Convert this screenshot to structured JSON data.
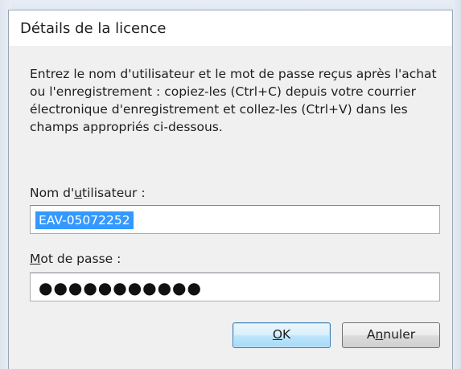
{
  "window": {
    "title": "Détails de la licence"
  },
  "instructions": "Entrez le nom d'utilisateur et le mot de passe reçus après l'achat ou l'enregistrement : copiez-les (Ctrl+C) depuis votre courrier électronique d'enregistrement et collez-les (Ctrl+V) dans les champs appropriés ci-dessous.",
  "username": {
    "label_before": "Nom d'",
    "label_accel": "u",
    "label_after": "tilisateur :",
    "value": "EAV-05072252"
  },
  "password": {
    "label_accel": "M",
    "label_after": "ot de passe :",
    "masked_value": "●●●●●●●●●●●"
  },
  "buttons": {
    "ok_accel": "O",
    "ok_after": "K",
    "cancel_before": "A",
    "cancel_accel": "n",
    "cancel_after": "nuler"
  }
}
